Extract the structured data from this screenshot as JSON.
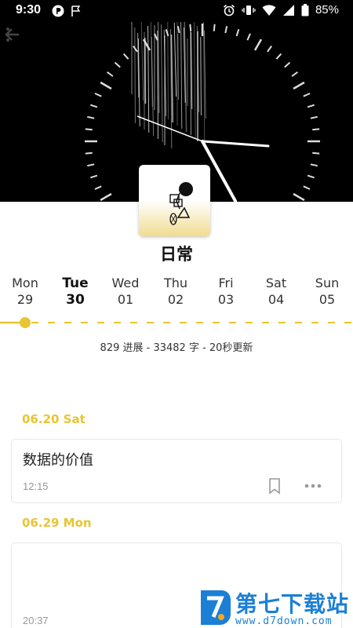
{
  "status_bar": {
    "time": "9:30",
    "battery": "85%"
  },
  "notebook": {
    "title": "日常"
  },
  "week": [
    {
      "name": "Mon",
      "num": "29",
      "active": false
    },
    {
      "name": "Tue",
      "num": "30",
      "active": true
    },
    {
      "name": "Wed",
      "num": "01",
      "active": false
    },
    {
      "name": "Thu",
      "num": "02",
      "active": false
    },
    {
      "name": "Fri",
      "num": "03",
      "active": false
    },
    {
      "name": "Sat",
      "num": "04",
      "active": false
    },
    {
      "name": "Sun",
      "num": "05",
      "active": false
    }
  ],
  "stats": "829 进展 - 33482 字 - 20秒更新",
  "entries": [
    {
      "date": "06.20 Sat",
      "title": "数据的价值",
      "time": "12:15"
    },
    {
      "date": "06.29 Mon",
      "title": "",
      "time": "20:37"
    }
  ],
  "watermark": {
    "title": "第七下载站",
    "url": "www.d7down.com"
  },
  "colors": {
    "accent": "#e9c531",
    "hero_bg": "#000000",
    "watermark": "#1c7fd6"
  }
}
